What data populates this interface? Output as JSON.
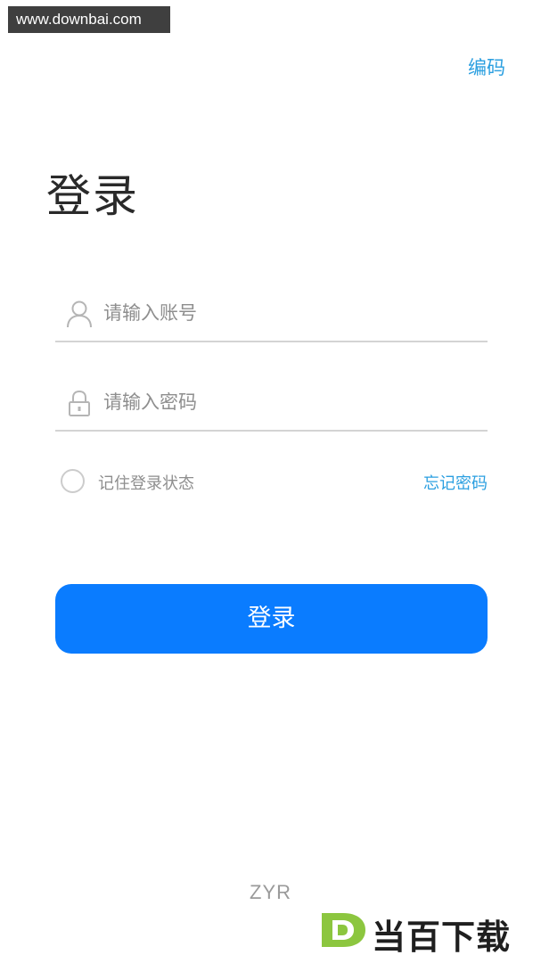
{
  "watermark": {
    "site": "www.downbai.com",
    "brand_name": "当百下载"
  },
  "header": {
    "encode_link": "编码"
  },
  "page": {
    "title": "登录"
  },
  "form": {
    "account_placeholder": "请输入账号",
    "account_icon": "user-icon",
    "password_placeholder": "请输入密码",
    "password_icon": "lock-icon",
    "remember_label": "记住登录状态",
    "remember_checked": false,
    "forgot_link": "忘记密码",
    "submit_label": "登录"
  },
  "footer": {
    "text": "ZYR"
  },
  "colors": {
    "accent_link": "#2b9fe0",
    "primary_button": "#0a7cff",
    "brand_green": "#8cc63f"
  }
}
